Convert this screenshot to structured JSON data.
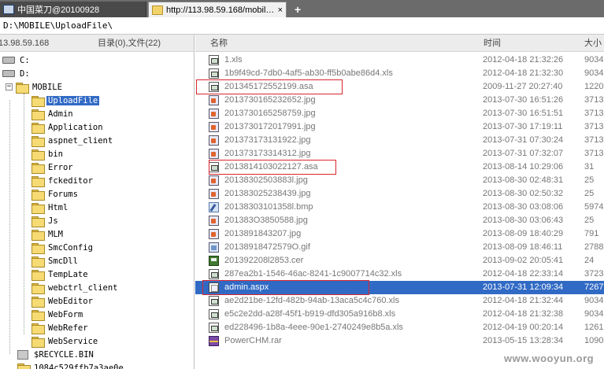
{
  "tabs": [
    {
      "label": "中国菜刀@20100928",
      "active": false
    },
    {
      "label": "http://113.98.59.168/mobile/...",
      "active": true
    }
  ],
  "tab_close": "×",
  "tab_new": "+",
  "address": "D:\\MOBILE\\UploadFile\\",
  "left_header": {
    "host": "13.98.59.168",
    "counts": "目录(0),文件(22)"
  },
  "tree": [
    {
      "label": "C:",
      "type": "drive",
      "level": 0
    },
    {
      "label": "D:",
      "type": "drive",
      "level": 0
    },
    {
      "label": "MOBILE",
      "type": "folder",
      "level": 1,
      "expander": "−"
    },
    {
      "label": "UploadFile",
      "type": "folder",
      "level": 2,
      "selected": true
    },
    {
      "label": "Admin",
      "type": "folder",
      "level": 2
    },
    {
      "label": "Application",
      "type": "folder",
      "level": 2
    },
    {
      "label": "aspnet_client",
      "type": "folder",
      "level": 2
    },
    {
      "label": "bin",
      "type": "folder",
      "level": 2
    },
    {
      "label": "Error",
      "type": "folder",
      "level": 2
    },
    {
      "label": "fckeditor",
      "type": "folder",
      "level": 2
    },
    {
      "label": "Forums",
      "type": "folder",
      "level": 2
    },
    {
      "label": "Html",
      "type": "folder",
      "level": 2
    },
    {
      "label": "Js",
      "type": "folder",
      "level": 2
    },
    {
      "label": "MLM",
      "type": "folder",
      "level": 2
    },
    {
      "label": "SmcConfig",
      "type": "folder",
      "level": 2
    },
    {
      "label": "SmcDll",
      "type": "folder",
      "level": 2
    },
    {
      "label": "TempLate",
      "type": "folder",
      "level": 2
    },
    {
      "label": "webctrl_client",
      "type": "folder",
      "level": 2
    },
    {
      "label": "WebEditor",
      "type": "folder",
      "level": 2
    },
    {
      "label": "WebForm",
      "type": "folder",
      "level": 2
    },
    {
      "label": "WebRefer",
      "type": "folder",
      "level": 2
    },
    {
      "label": "WebService",
      "type": "folder",
      "level": 2
    },
    {
      "label": "$RECYCLE.BIN",
      "type": "recycle",
      "level": 1
    },
    {
      "label": "1084c529ffb7a3ae0e",
      "type": "folder",
      "level": 1
    }
  ],
  "columns": {
    "name": "名称",
    "time": "时间",
    "size": "大小"
  },
  "files": [
    {
      "name": "1.xls",
      "icon": "xls",
      "time": "2012-04-18 21:32:26",
      "size": "9034"
    },
    {
      "name": "1b9f49cd-7db0-4af5-ab30-ff5b0abe86d4.xls",
      "icon": "xls",
      "time": "2012-04-18 21:32:30",
      "size": "9034"
    },
    {
      "name": "201345172552199.asa",
      "icon": "xls",
      "time": "2009-11-27 20:27:40",
      "size": "1220",
      "highlighted": true
    },
    {
      "name": "2013730165232652.jpg",
      "icon": "jpg",
      "time": "2013-07-30 16:51:26",
      "size": "3713"
    },
    {
      "name": "2013730165258759.jpg",
      "icon": "jpg",
      "time": "2013-07-30 16:51:51",
      "size": "3713"
    },
    {
      "name": "2013730172017991.jpg",
      "icon": "jpg",
      "time": "2013-07-30 17:19:11",
      "size": "3713"
    },
    {
      "name": "201373173131922.jpg",
      "icon": "jpg",
      "time": "2013-07-31 07:30:24",
      "size": "3713"
    },
    {
      "name": "201373173314312.jpg",
      "icon": "jpg",
      "time": "2013-07-31 07:32:07",
      "size": "3713"
    },
    {
      "name": "2013814103022127.asa",
      "icon": "xls",
      "time": "2013-08-14 10:29:06",
      "size": "31",
      "highlighted": true
    },
    {
      "name": "20138302503883l.jpg",
      "icon": "jpg",
      "time": "2013-08-30 02:48:31",
      "size": "25"
    },
    {
      "name": "201383025238439.jpg",
      "icon": "jpg",
      "time": "2013-08-30 02:50:32",
      "size": "25"
    },
    {
      "name": "20138303101358l.bmp",
      "icon": "bmp",
      "time": "2013-08-30 03:08:06",
      "size": "5974"
    },
    {
      "name": "201383O3850588.jpg",
      "icon": "jpg",
      "time": "2013-08-30 03:06:43",
      "size": "25"
    },
    {
      "name": "2013891843207.jpg",
      "icon": "jpg",
      "time": "2013-08-09 18:40:29",
      "size": "791"
    },
    {
      "name": "20138918472579O.gif",
      "icon": "gif",
      "time": "2013-08-09 18:46:11",
      "size": "2788"
    },
    {
      "name": "201392208l2853.cer",
      "icon": "cer",
      "time": "2013-09-02 20:05:41",
      "size": "24"
    },
    {
      "name": "287ea2b1-1546-46ac-8241-1c9007714c32.xls",
      "icon": "xls",
      "time": "2012-04-18 22:33:14",
      "size": "3723"
    },
    {
      "name": "admin.aspx",
      "icon": "aspx",
      "time": "2013-07-31 12:09:34",
      "size": "7267",
      "highlighted": true,
      "selected": true
    },
    {
      "name": "ae2d21be-12fd-482b-94ab-13aca5c4c760.xls",
      "icon": "xls",
      "time": "2012-04-18 21:32:44",
      "size": "9034"
    },
    {
      "name": "e5c2e2dd-a28f-45f1-b919-dfd305a916b8.xls",
      "icon": "xls",
      "time": "2012-04-18 21:32:38",
      "size": "9034"
    },
    {
      "name": "ed228496-1b8a-4eee-90e1-2740249e8b5a.xls",
      "icon": "xls",
      "time": "2012-04-19 00:20:14",
      "size": "1261"
    },
    {
      "name": "PowerCHM.rar",
      "icon": "rar",
      "time": "2013-05-15 13:28:34",
      "size": "1090"
    }
  ],
  "watermark": "www.wooyun.org",
  "colors": {
    "selection": "#316ac5",
    "highlight_box": "#d8262f",
    "tab_bar": "#6b6b6b"
  }
}
